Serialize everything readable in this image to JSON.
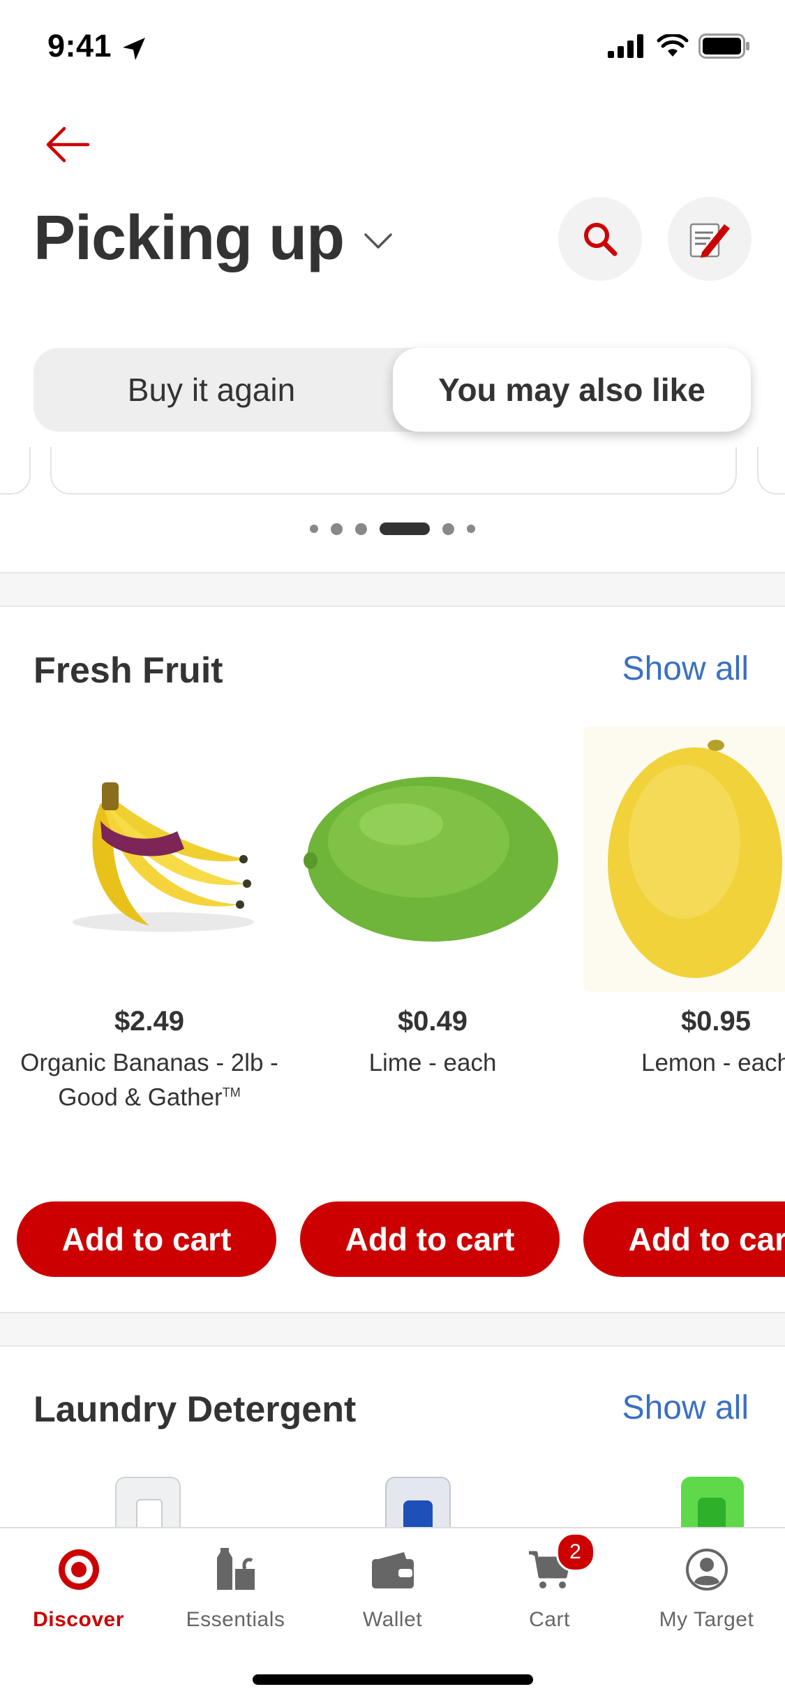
{
  "status_bar": {
    "time": "9:41"
  },
  "header": {
    "title": "Picking up"
  },
  "tabs": {
    "buy_again": "Buy it again",
    "you_may_like": "You may also like",
    "active": "you_may_like"
  },
  "carousel": {
    "dots": 6,
    "active_index": 3
  },
  "fresh_fruit": {
    "title": "Fresh Fruit",
    "show_all": "Show all",
    "products": [
      {
        "price": "$2.49",
        "name": "Organic Bananas - 2lb - Good & Gather",
        "trademark": "TM",
        "image": "banana-bunch",
        "button": "Add to cart"
      },
      {
        "price": "$0.49",
        "name": "Lime - each",
        "image": "lime",
        "button": "Add to cart"
      },
      {
        "price": "$0.95",
        "name": "Lemon - each",
        "image": "lemon",
        "button": "Add to cart"
      }
    ]
  },
  "laundry": {
    "title": "Laundry Detergent",
    "show_all": "Show all"
  },
  "tab_bar": {
    "items": [
      {
        "label": "Discover",
        "icon": "target-bullseye-icon",
        "active": true
      },
      {
        "label": "Essentials",
        "icon": "essentials-icon"
      },
      {
        "label": "Wallet",
        "icon": "wallet-icon"
      },
      {
        "label": "Cart",
        "icon": "cart-icon",
        "badge": "2"
      },
      {
        "label": "My Target",
        "icon": "account-icon"
      }
    ]
  },
  "colors": {
    "brand": "#cc0000",
    "link": "#3a6fc4",
    "text": "#333333"
  }
}
